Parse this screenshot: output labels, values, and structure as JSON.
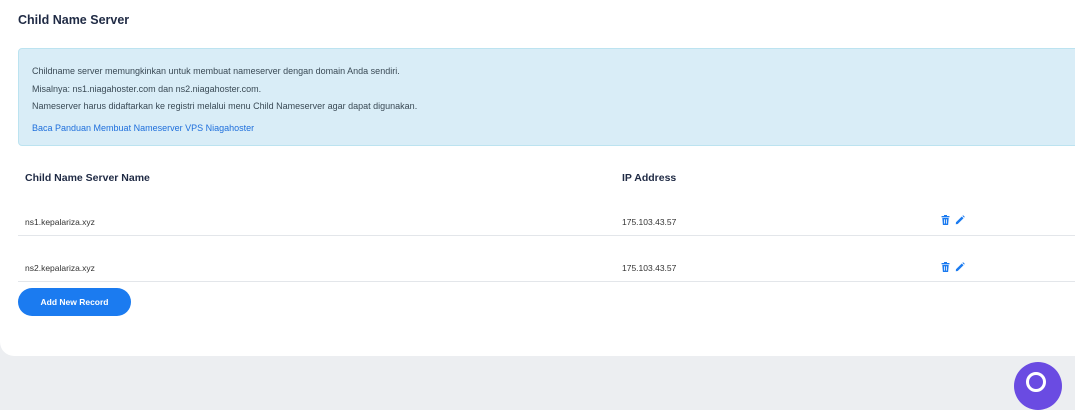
{
  "section_title": "Child Name Server",
  "info": {
    "lines": [
      "Childname server memungkinkan untuk membuat nameserver dengan domain Anda sendiri.",
      "Misalnya: ns1.niagahoster.com dan ns2.niagahoster.com.",
      "Nameserver harus didaftarkan ke registri melalui menu Child Nameserver agar dapat digunakan."
    ],
    "link_text": "Baca Panduan Membuat Nameserver VPS Niagahoster"
  },
  "table": {
    "headers": [
      "Child Name Server Name",
      "IP Address"
    ],
    "rows": [
      {
        "name": "ns1.kepalariza.xyz",
        "ip": "175.103.43.57"
      },
      {
        "name": "ns2.kepalariza.xyz",
        "ip": "175.103.43.57"
      }
    ]
  },
  "add_button_label": "Add New Record",
  "icons": {
    "delete": "trash-icon",
    "edit": "pencil-icon",
    "chat": "chat-icon"
  },
  "colors": {
    "accent": "#1b7bf0",
    "info_bg": "#d9edf7",
    "chat_fab": "#6a4be2"
  }
}
